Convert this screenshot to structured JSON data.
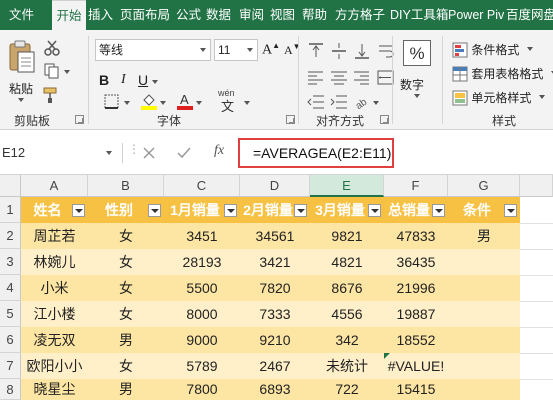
{
  "tabs": [
    {
      "label": "文件",
      "active": false
    },
    {
      "label": "开始",
      "active": true
    },
    {
      "label": "插入",
      "active": false
    },
    {
      "label": "页面布局",
      "active": false
    },
    {
      "label": "公式",
      "active": false
    },
    {
      "label": "数据",
      "active": false
    },
    {
      "label": "审阅",
      "active": false
    },
    {
      "label": "视图",
      "active": false
    },
    {
      "label": "帮助",
      "active": false
    },
    {
      "label": "方方格子",
      "active": false
    },
    {
      "label": "DIY工具箱",
      "active": false
    },
    {
      "label": "Power Pivot",
      "active": false
    },
    {
      "label": "百度网盘",
      "active": false
    }
  ],
  "ribbon": {
    "clipboard": {
      "paste_label": "粘贴",
      "group_label": "剪贴板"
    },
    "font": {
      "font_name": "等线",
      "font_size": "11",
      "group_label": "字体",
      "wen_glyph": "wén"
    },
    "alignment": {
      "group_label": "对齐方式"
    },
    "number": {
      "label": "数字",
      "symbol": "%"
    },
    "styles": {
      "conditional_format": "条件格式",
      "table_format": "套用表格格式",
      "cell_styles": "单元格样式",
      "group_label": "样式"
    }
  },
  "formula_bar": {
    "name_box": "E12",
    "formula": "=AVERAGEA(E2:E11)",
    "fx_label": "fx"
  },
  "colors": {
    "header_fill": "#f7c244",
    "band_dark": "#fde6a3",
    "band_light": "#fff0c9",
    "excel_green": "#217346",
    "highlight_red": "#e04040"
  },
  "sheet": {
    "columns": [
      "A",
      "B",
      "C",
      "D",
      "E",
      "F",
      "G"
    ],
    "rows": [
      "1",
      "2",
      "3",
      "4",
      "5",
      "6",
      "7",
      "8"
    ],
    "headers": [
      "姓名",
      "性别",
      "1月销量",
      "2月销量",
      "3月销量",
      "总销量",
      "条件"
    ],
    "data": [
      [
        "周芷若",
        "女",
        "3451",
        "34561",
        "9821",
        "47833",
        "男"
      ],
      [
        "林婉儿",
        "女",
        "28193",
        "3421",
        "4821",
        "36435",
        ""
      ],
      [
        "小米",
        "女",
        "5500",
        "7820",
        "8676",
        "21996",
        ""
      ],
      [
        "江小楼",
        "女",
        "8000",
        "7333",
        "4556",
        "19887",
        ""
      ],
      [
        "凌无双",
        "男",
        "9000",
        "9210",
        "342",
        "18552",
        ""
      ],
      [
        "欧阳小小",
        "女",
        "5789",
        "2467",
        "未统计",
        "#VALUE!",
        ""
      ],
      [
        "晓星尘",
        "男",
        "7800",
        "6893",
        "722",
        "15415",
        ""
      ]
    ]
  }
}
